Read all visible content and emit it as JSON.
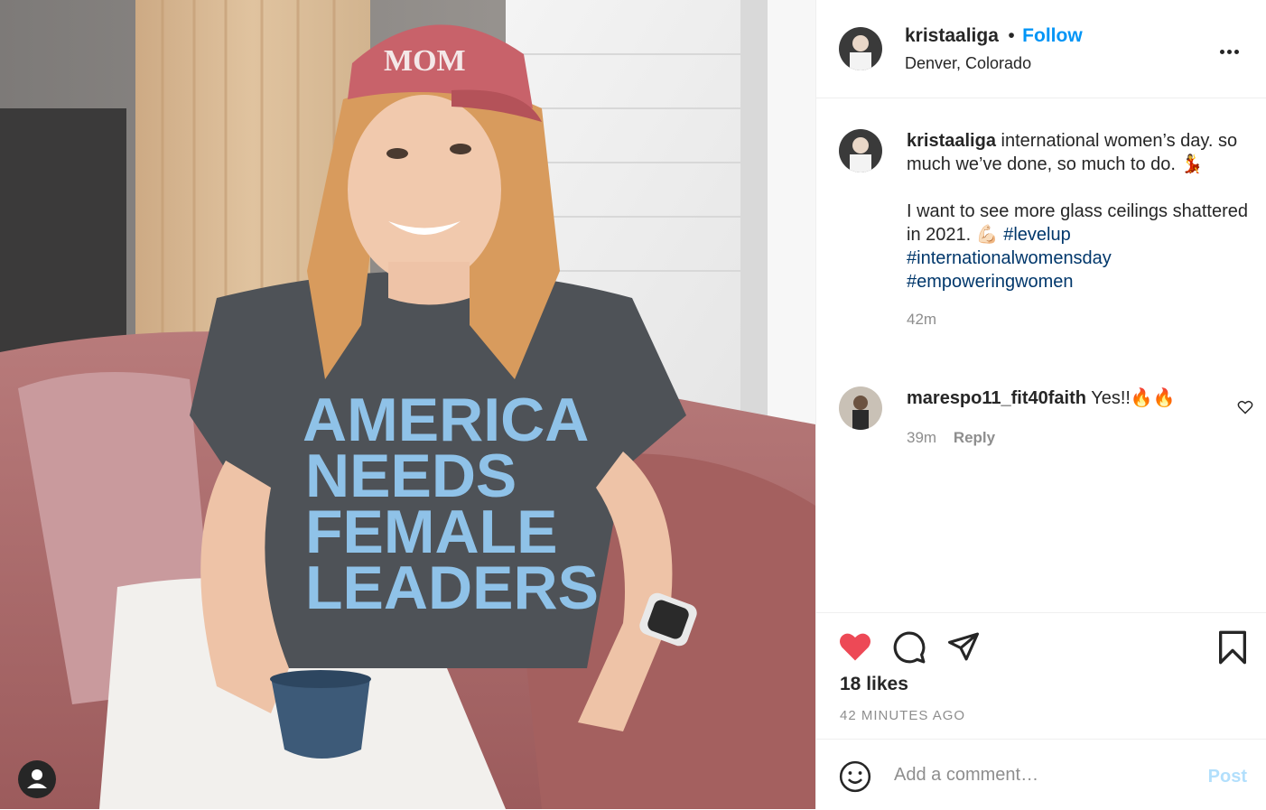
{
  "post": {
    "username": "kristaaliga",
    "follow_label": "Follow",
    "separator": "•",
    "location": "Denver, Colorado",
    "caption_line1": "international women’s day. so much we’ve done, so much to do.",
    "caption_emoji1": "💃",
    "caption_line2": "I want to see more glass ceilings shattered in 2021.",
    "caption_emoji2": "💪🏻",
    "hashtags": [
      "#levelup",
      "#internationalwomensday",
      "#empoweringwomen"
    ],
    "caption_time": "42m"
  },
  "photo": {
    "hat_text": "MOM",
    "shirt_lines": [
      "AMERICA",
      "NEEDS",
      "FEMALE",
      "LEADERS"
    ]
  },
  "comments": [
    {
      "username": "marespo11_fit40faith",
      "text": "Yes!!🔥🔥",
      "time": "39m",
      "reply_label": "Reply"
    }
  ],
  "footer": {
    "likes": "18 likes",
    "time_ago": "42 MINUTES AGO",
    "comment_placeholder": "Add a comment…",
    "post_label": "Post"
  },
  "colors": {
    "accent": "#0095f6",
    "like_red": "#ed4956",
    "hashtag": "#00376b",
    "muted": "#8e8e8e"
  },
  "icons": [
    "heart-icon",
    "comment-icon",
    "share-icon",
    "bookmark-icon",
    "emoji-icon",
    "more-icon",
    "profile-icon"
  ]
}
